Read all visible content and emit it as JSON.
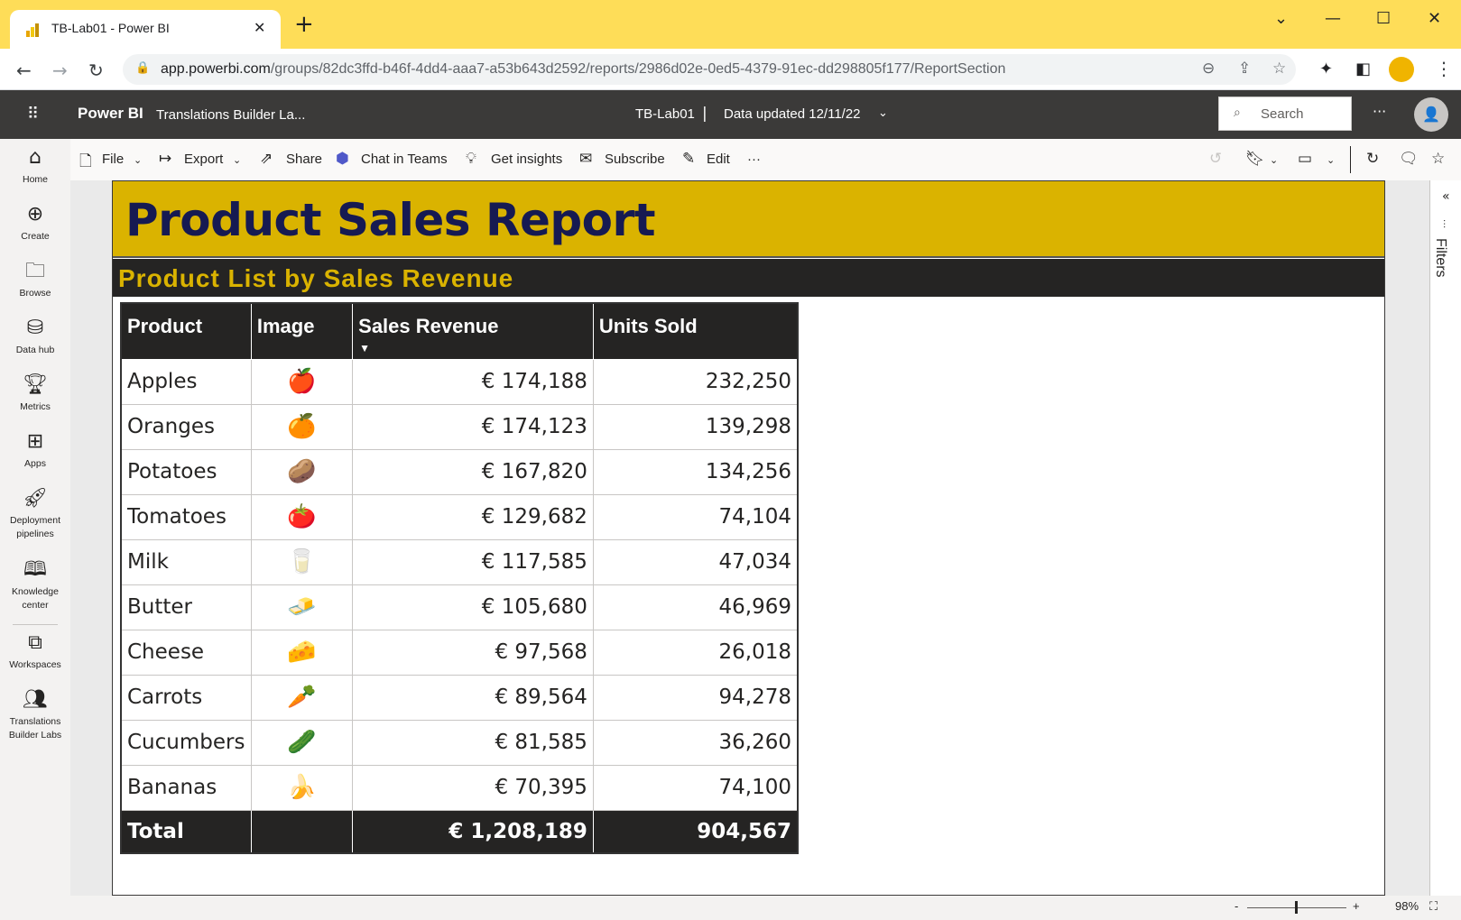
{
  "browser": {
    "tab_title": "TB-Lab01 - Power BI",
    "url_host": "app.powerbi.com",
    "url_path": "/groups/82dc3ffd-b46f-4dd4-aaa7-a53b643d2592/reports/2986d02e-0ed5-4379-91ec-dd298805f177/ReportSection"
  },
  "header": {
    "brand": "Power BI",
    "workspace": "Translations Builder La...",
    "report_name": "TB-Lab01",
    "separator": "|",
    "data_updated": "Data updated 12/11/22",
    "search_placeholder": "Search"
  },
  "leftnav": {
    "items": [
      {
        "label": "Home",
        "icon": "home-icon"
      },
      {
        "label": "Create",
        "icon": "create-icon"
      },
      {
        "label": "Browse",
        "icon": "browse-icon"
      },
      {
        "label": "Data hub",
        "icon": "data-hub-icon"
      },
      {
        "label": "Metrics",
        "icon": "metrics-icon"
      },
      {
        "label": "Apps",
        "icon": "apps-icon"
      },
      {
        "label": "Deployment pipelines",
        "icon": "deployment-pipelines-icon"
      },
      {
        "label": "Knowledge center",
        "icon": "knowledge-center-icon"
      },
      {
        "label": "Workspaces",
        "icon": "workspaces-icon"
      },
      {
        "label": "Translations Builder Labs",
        "icon": "workspace-group-icon"
      }
    ]
  },
  "actionbar": {
    "file": "File",
    "export": "Export",
    "share": "Share",
    "chat_in_teams": "Chat in Teams",
    "get_insights": "Get insights",
    "subscribe": "Subscribe",
    "edit": "Edit",
    "more": "···"
  },
  "report": {
    "title": "Product Sales Report",
    "subtitle": "Product List by Sales Revenue",
    "columns": [
      "Product",
      "Image",
      "Sales Revenue",
      "Units Sold"
    ],
    "rows": [
      {
        "product": "Apples",
        "image": "🍎",
        "revenue": "€ 174,188",
        "units": "232,250"
      },
      {
        "product": "Oranges",
        "image": "🍊",
        "revenue": "€ 174,123",
        "units": "139,298"
      },
      {
        "product": "Potatoes",
        "image": "🥔",
        "revenue": "€ 167,820",
        "units": "134,256"
      },
      {
        "product": "Tomatoes",
        "image": "🍅",
        "revenue": "€ 129,682",
        "units": "74,104"
      },
      {
        "product": "Milk",
        "image": "🥛",
        "revenue": "€ 117,585",
        "units": "47,034"
      },
      {
        "product": "Butter",
        "image": "🧈",
        "revenue": "€ 105,680",
        "units": "46,969"
      },
      {
        "product": "Cheese",
        "image": "🧀",
        "revenue": "€ 97,568",
        "units": "26,018"
      },
      {
        "product": "Carrots",
        "image": "🥕",
        "revenue": "€ 89,564",
        "units": "94,278"
      },
      {
        "product": "Cucumbers",
        "image": "🥒",
        "revenue": "€ 81,585",
        "units": "36,260"
      },
      {
        "product": "Bananas",
        "image": "🍌",
        "revenue": "€ 70,395",
        "units": "74,100"
      }
    ],
    "total": {
      "label": "Total",
      "revenue": "€ 1,208,189",
      "units": "904,567"
    }
  },
  "filters": {
    "label": "Filters"
  },
  "statusbar": {
    "zoom_minus": "-",
    "zoom_plus": "+",
    "zoom_level": "98%"
  },
  "colors": {
    "banner": "#dab300",
    "banner_text": "#161a52",
    "header": "#3b3a39",
    "tabbar": "#fedd58",
    "table_header": "#252423"
  }
}
